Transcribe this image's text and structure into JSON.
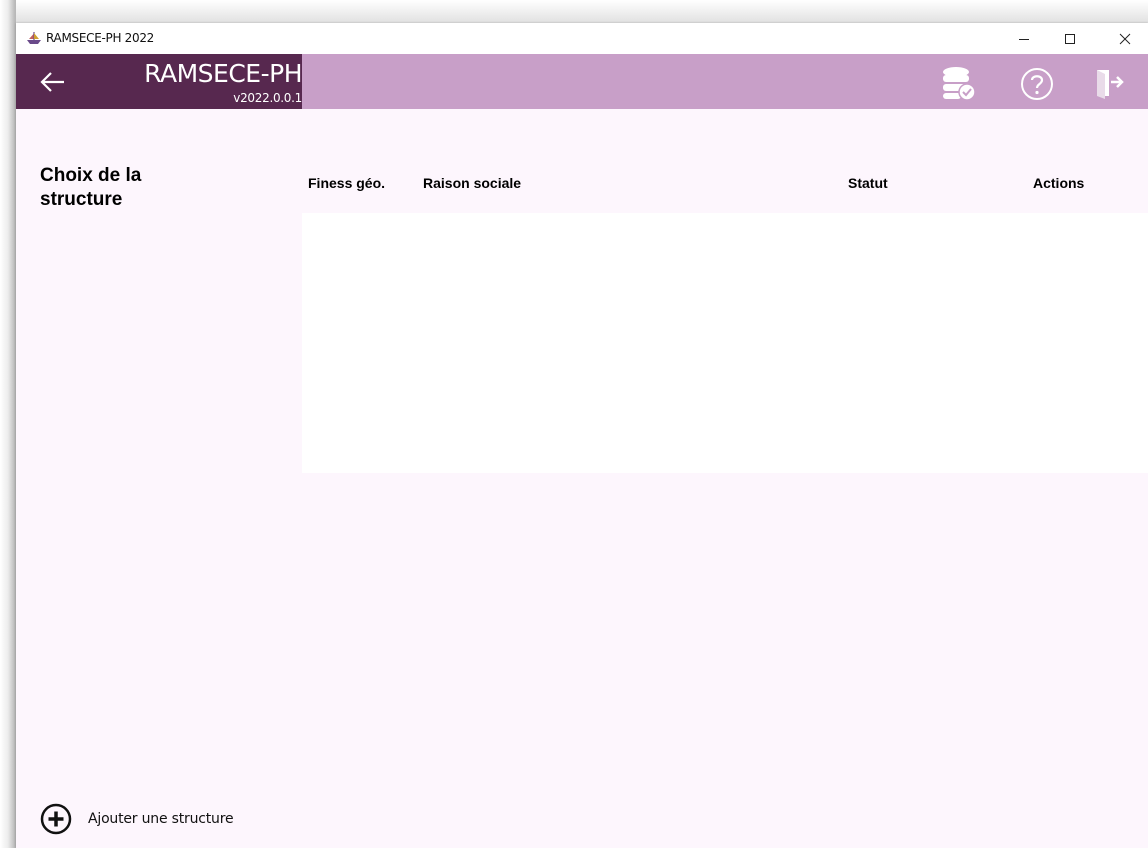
{
  "window": {
    "title": "RAMSECE-PH 2022",
    "app_icon": "boat-icon"
  },
  "header": {
    "app_name": "RAMSECE-PH",
    "version": "v2022.0.0.1",
    "back_icon": "back-arrow-icon",
    "icons": [
      "database-check-icon",
      "help-icon",
      "exit-icon"
    ],
    "colors": {
      "left_panel": "#57284f",
      "bar": "#c89fc8",
      "content_bg": "#fdf6fd"
    }
  },
  "sidebar": {
    "title": "Choix de la structure"
  },
  "table": {
    "columns": [
      "Finess géo.",
      "Raison sociale",
      "Statut",
      "Actions"
    ],
    "rows": []
  },
  "footer": {
    "add_label": "Ajouter une structure",
    "add_icon": "plus-circle-icon"
  }
}
